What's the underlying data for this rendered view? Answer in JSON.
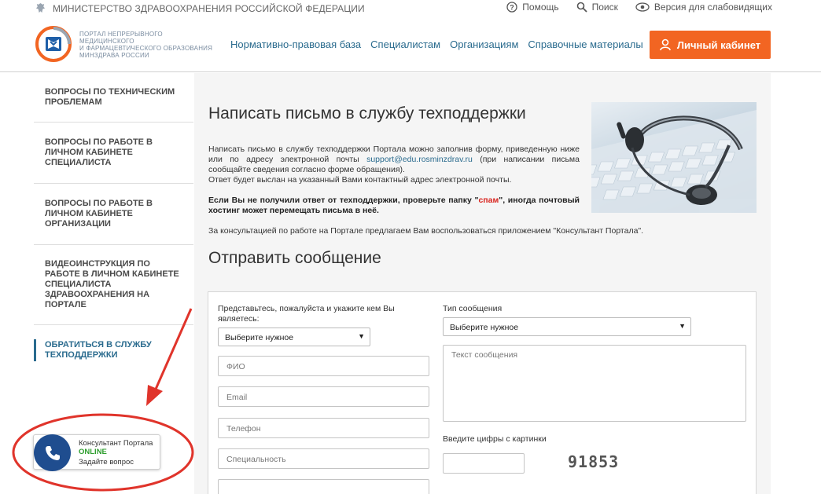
{
  "top": {
    "ministry": "МИНИСТЕРСТВО ЗДРАВООХРАНЕНИЯ РОССИЙСКОЙ ФЕДЕРАЦИИ",
    "help": "Помощь",
    "search": "Поиск",
    "accessibility": "Версия для слабовидящих"
  },
  "header": {
    "logo_text": [
      "ПОРТАЛ НЕПРЕРЫВНОГО",
      "МЕДИЦИНСКОГО",
      "И ФАРМАЦЕВТИЧЕСКОГО ОБРАЗОВАНИЯ",
      "МИНЗДРАВА РОССИИ"
    ],
    "nav": [
      "Нормативно-правовая база",
      "Специалистам",
      "Организациям",
      "Справочные материалы"
    ],
    "cabinet_button": "Личный кабинет",
    "accent_color": "#f26522"
  },
  "sidebar": {
    "items": [
      {
        "label": "ВОПРОСЫ ПО ТЕХНИЧЕСКИМ ПРОБЛЕМАМ"
      },
      {
        "label": "ВОПРОСЫ ПО РАБОТЕ В ЛИЧНОМ КАБИНЕТЕ СПЕЦИАЛИСТА"
      },
      {
        "label": "ВОПРОСЫ ПО РАБОТЕ В ЛИЧНОМ КАБИНЕТЕ ОРГАНИЗАЦИИ"
      },
      {
        "label": "ВИДЕОИНСТРУКЦИЯ ПО РАБОТЕ В ЛИЧНОМ КАБИНЕТЕ СПЕЦИАЛИСТА ЗДРАВООХРАНЕНИЯ НА ПОРТАЛЕ"
      },
      {
        "label": "ОБРАТИТЬСЯ В СЛУЖБУ ТЕХПОДДЕРЖКИ"
      }
    ]
  },
  "main": {
    "title": "Написать письмо в службу техподдержки",
    "intro_1": "Написать письмо в службу техподдержки Портала можно заполнив форму, приведенную ниже или по адресу электронной почты ",
    "email": "support@edu.rosminzdrav.ru",
    "intro_2": " (при написании письма сообщайте сведения согласно форме обращения).",
    "intro_3": "Ответ будет выслан на указанный Вами контактный адрес электронной почты.",
    "note_1": "Если Вы не получили ответ от техподдержки, проверьте папку \"",
    "note_spam": "спам",
    "note_2": "\", иногда почтовый хостинг может перемещать письма в неё.",
    "consult": "За консультацией по работе на Портале предлагаем Вам воспользоваться приложением \"Консультант Портала\".",
    "subtitle": "Отправить сообщение"
  },
  "form": {
    "who_label": "Представьтесь, пожалуйста и укажите кем Вы являетесь:",
    "who_value": "Выберите нужное",
    "type_label": "Тип сообщения",
    "type_value": "Выберите нужное",
    "fio_placeholder": "ФИО",
    "email_placeholder": "Email",
    "phone_placeholder": "Телефон",
    "spec_placeholder": "Специальность",
    "message_placeholder": "Текст сообщения",
    "captcha_label": "Введите цифры с картинки",
    "captcha_value": "91853"
  },
  "widget": {
    "title": "Консультант Портала",
    "status": "ONLINE",
    "action": "Задайте вопрос",
    "status_color": "#2e9e2e"
  },
  "annotation_color": "#e0342b"
}
